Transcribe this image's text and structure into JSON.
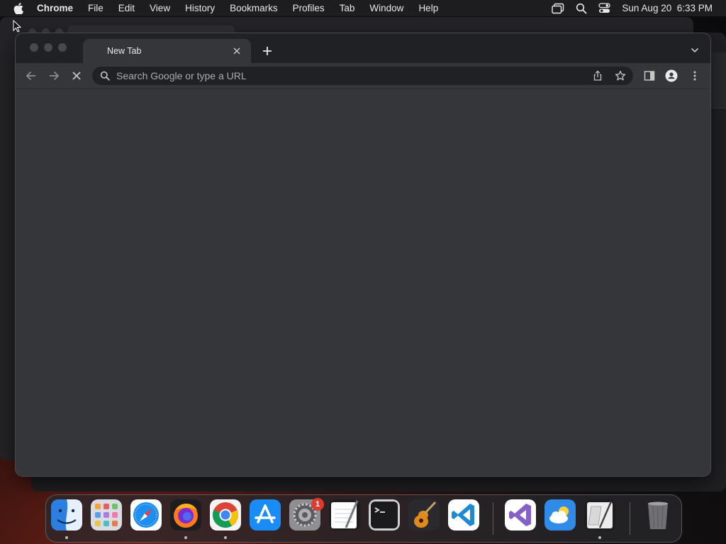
{
  "menubar": {
    "app_name": "Chrome",
    "menus": [
      "File",
      "Edit",
      "View",
      "History",
      "Bookmarks",
      "Profiles",
      "Tab",
      "Window",
      "Help"
    ],
    "datetime": "Sun Aug 20  6:33 PM",
    "status_icons": [
      "screen-mirroring-icon",
      "spotlight-search-icon",
      "control-center-icon"
    ]
  },
  "browser": {
    "tab_title": "New Tab",
    "omnibox_placeholder": "Search Google or type a URL",
    "theme": {
      "frame": "#202124",
      "toolbar": "#35363a",
      "omnibox": "#202124"
    }
  },
  "dock": {
    "apps": [
      "Finder",
      "Launchpad",
      "Safari",
      "Firefox",
      "Google Chrome",
      "App Store",
      "System Settings",
      "TextEdit",
      "Terminal",
      "GarageBand",
      "Visual Studio Code",
      "Visual Studio",
      "Weather",
      "Script Editor",
      "Trash"
    ],
    "system_settings_badge": "1"
  }
}
